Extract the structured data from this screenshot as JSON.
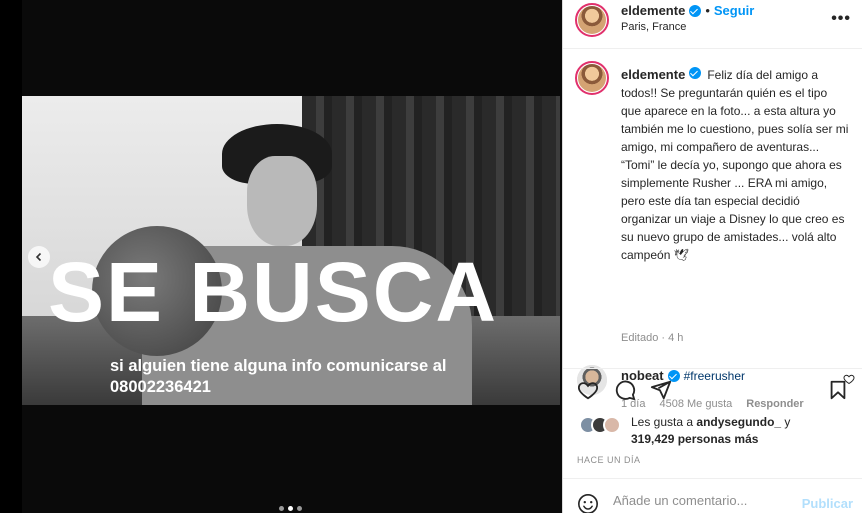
{
  "post": {
    "overlay_title": "SE BUSCA",
    "overlay_subtitle": "si alguien tiene alguna info comunicarse al",
    "overlay_phone": "08002236421"
  },
  "header": {
    "username": "eldemente",
    "separator": "•",
    "follow_label": "Seguir",
    "location": "Paris, France",
    "more_icon": "•••"
  },
  "caption": {
    "username": "eldemente",
    "text": "Feliz día del amigo a todos!! Se preguntarán quién es el tipo que aparece en la foto... a esta altura yo también me lo cuestiono, pues solía ser mi amigo, mi compañero de aventuras... “Tomi” le decía yo, supongo que ahora es simplemente Rusher ... ERA mi amigo, pero este día tan especial decidió organizar un viaje a Disney lo que creo es su nuevo grupo de amistades... volá alto campeón 🕊",
    "edited": "Editado · 4 h"
  },
  "reply": {
    "username": "nobeat",
    "hashtag": "#freerusher",
    "age": "1 día",
    "likes": "4508 Me gusta",
    "reply_label": "Responder"
  },
  "likes": {
    "prefix": "Les gusta a ",
    "user": "andysegundo_",
    "suffix": " y",
    "count": "319,429 personas más"
  },
  "time_ago": "HACE UN DÍA",
  "add_comment": {
    "placeholder": "Añade un comentario...",
    "publish_label": "Publicar"
  },
  "colors": {
    "accent": "#0095f6",
    "publish_disabled": "#b2dffc",
    "story_ring": "#e1306c"
  }
}
